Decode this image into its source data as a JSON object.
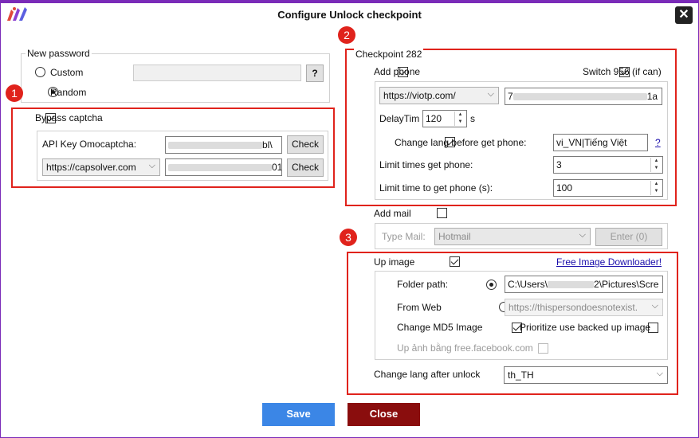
{
  "window": {
    "title": "Configure Unlock checkpoint",
    "close_symbol": "✕"
  },
  "password": {
    "group_label": "New password",
    "custom_label": "Custom",
    "random_label": "Random",
    "help_button": "?"
  },
  "badges": {
    "one": "1",
    "two": "2",
    "three": "3"
  },
  "captcha": {
    "bypass_label": "Bypass captcha",
    "api_key_label": "API Key Omocaptcha:",
    "api_key_suffix": "bl\\",
    "check1": "Check",
    "provider": "https://capsolver.com",
    "provider_suffix": "01",
    "check2": "Check"
  },
  "checkpoint": {
    "group_label": "Checkpoint 282",
    "add_phone_label": "Add phone",
    "switch_label": "Switch 956 (if can)",
    "phone_site": "https://viotp.com/",
    "phone_key_prefix": "7",
    "phone_key_suffix": "1a",
    "delay_label": "DelayTim",
    "delay_value": "120",
    "delay_unit": "s",
    "change_lang_label": "Change lang before get phone:",
    "lang_value": "vi_VN|Tiếng Việt",
    "lang_help": "?",
    "limit_times_label": "Limit times get phone:",
    "limit_times_value": "3",
    "limit_time_label": "Limit time to get phone (s):",
    "limit_time_value": "100"
  },
  "mail": {
    "add_mail_label": "Add mail",
    "type_label": "Type Mail:",
    "type_value": "Hotmail",
    "enter_button": "Enter (0)"
  },
  "upimage": {
    "up_image_label": "Up image",
    "downloader_link": "Free Image Downloader!",
    "folder_label": "Folder path:",
    "folder_prefix": "C:\\Users\\",
    "folder_suffix": "2\\Pictures\\Scre",
    "web_label": "From Web",
    "web_value": "https://thispersondoesnotexist.",
    "md5_label": "Change MD5 Image",
    "prioritize_label": "Prioritize use backed up image",
    "facebook_label": "Up ảnh bằng free.facebook.com"
  },
  "after_unlock": {
    "label": "Change lang after unlock",
    "value": "th_TH"
  },
  "footer": {
    "save": "Save",
    "close": "Close"
  },
  "colors": {
    "accent": "#7a2bb8",
    "highlight": "#e0231c",
    "save": "#3b86e6",
    "close": "#8a0d0d"
  }
}
